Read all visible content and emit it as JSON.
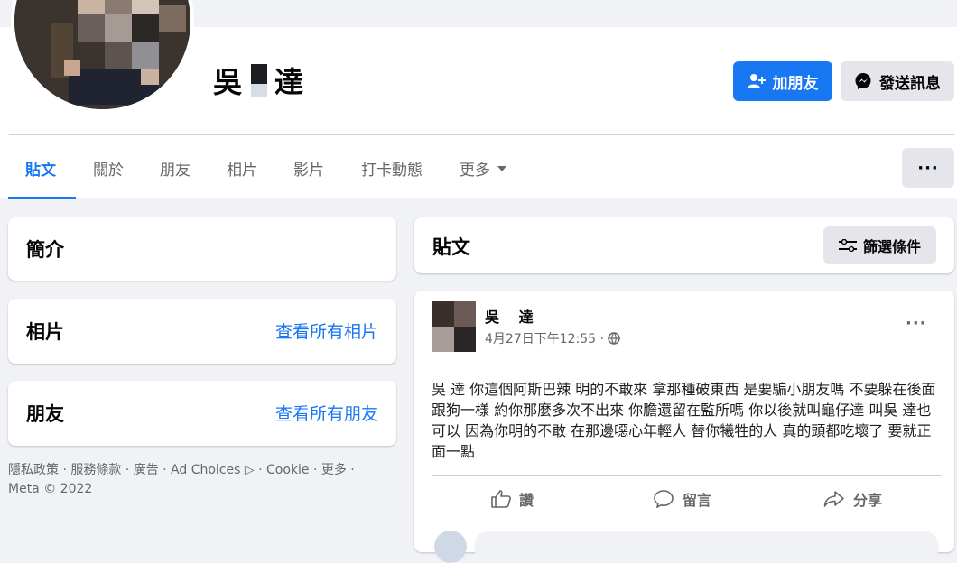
{
  "profile": {
    "name_prefix": "吳",
    "name_suffix": "達"
  },
  "header": {
    "add_friend_label": "加朋友",
    "message_label": "發送訊息",
    "overflow_label": "···"
  },
  "tabs": {
    "posts": "貼文",
    "about": "關於",
    "friends": "朋友",
    "photos": "相片",
    "videos": "影片",
    "checkins": "打卡動態",
    "more": "更多"
  },
  "sidebar": {
    "intro_title": "簡介",
    "photos_title": "相片",
    "photos_link": "查看所有相片",
    "friends_title": "朋友",
    "friends_link": "查看所有朋友",
    "footer": "隱私政策 · 服務條款 · 廣告 · Ad Choices ▷ · Cookie · 更多 · Meta © 2022"
  },
  "posts_header": {
    "title": "貼文",
    "filter_label": "篩選條件"
  },
  "post": {
    "author": "吳 達",
    "timestamp": "4月27日下午12:55 ·",
    "text": "吳 達 你這個阿斯巴辣 明的不敢來 拿那種破東西 是要騙小朋友嗎 不要躲在後面跟狗一樣 約你那麼多次不出來 你膽還留在監所嗎 你以後就叫龜仔達 叫吳 達也可以 因為你明的不敢 在那邊噁心年輕人 替你犧牲的人 真的頭都吃壞了 要就正面一點",
    "menu_label": "···",
    "actions": {
      "like": "讚",
      "comment": "留言",
      "share": "分享"
    }
  },
  "colors": {
    "accent": "#1877f2",
    "background": "#f0f2f5",
    "secondary_text": "#65676b"
  },
  "icons": [
    "add-friend-icon",
    "messenger-icon",
    "caret-down-icon",
    "filter-icon",
    "globe-icon",
    "like-icon",
    "comment-icon",
    "share-icon"
  ]
}
